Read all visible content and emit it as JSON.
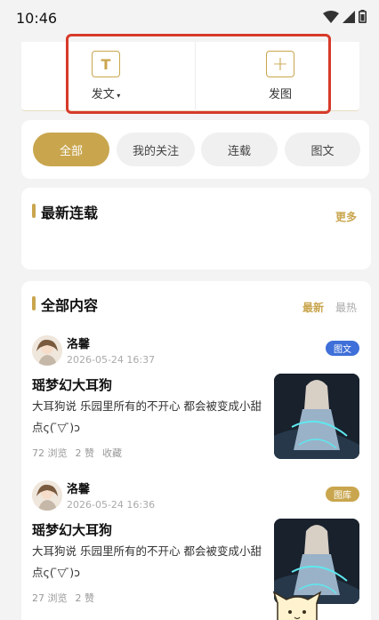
{
  "status": {
    "time": "10:46"
  },
  "compose": {
    "text_label": "发文",
    "text_icon": "T",
    "image_label": "发图",
    "image_icon": "+"
  },
  "filters": [
    {
      "label": "全部",
      "active": true
    },
    {
      "label": "我的关注",
      "active": false
    },
    {
      "label": "连载",
      "active": false
    },
    {
      "label": "图文",
      "active": false
    }
  ],
  "serial": {
    "title": "最新连载",
    "more": "更多"
  },
  "content": {
    "title": "全部内容",
    "sort_latest": "最新",
    "sort_hot": "最热"
  },
  "posts": [
    {
      "author": "洛馨",
      "date": "2026-05-24 16:37",
      "badge": "图文",
      "badge_color": "#3f6fd8",
      "title": "瑶梦幻大耳狗",
      "body": "大耳狗说 乐园里所有的不开心 都会被变成小甜点ς( ̄▽ ̄)ɔ",
      "views": "72 浏览",
      "likes": "2 赞",
      "collect": "收藏"
    },
    {
      "author": "洛馨",
      "date": "2026-05-24 16:36",
      "badge": "图库",
      "badge_color": "#c9a64e",
      "title": "瑶梦幻大耳狗",
      "body": "大耳狗说 乐园里所有的不开心 都会被变成小甜点ς( ̄▽ ̄)ɔ",
      "views": "27 浏览",
      "likes": "2 赞"
    }
  ],
  "colors": {
    "accent": "#c9a64e",
    "highlight": "#d73a2a"
  }
}
